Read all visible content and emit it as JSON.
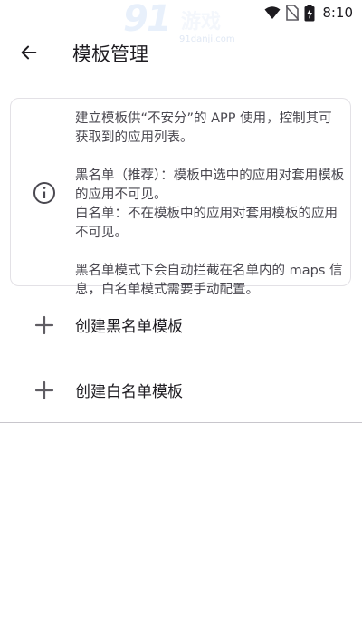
{
  "status_bar": {
    "time": "8:10",
    "icons": [
      "wifi-icon",
      "no-sim-icon",
      "battery-charging-icon"
    ]
  },
  "watermark": {
    "logo_number": "91",
    "logo_text": "游戏",
    "url": "91danji.com"
  },
  "app_bar": {
    "back_icon": "arrow-back-icon",
    "title": "模板管理"
  },
  "info_card": {
    "icon": "info-icon",
    "intro": "建立模板供“不安分”的 APP 使用，控制其可获取到的应用列表。",
    "blacklist_desc": "黑名单（推荐）：模板中选中的应用对套用模板的应用不可见。",
    "whitelist_desc": "白名单：不在模板中的应用对套用模板的应用不可见。",
    "note": "黑名单模式下会自动拦截在名单内的 maps 信息，白名单模式需要手动配置。"
  },
  "actions": [
    {
      "icon": "plus-icon",
      "label": "创建黑名单模板"
    },
    {
      "icon": "plus-icon",
      "label": "创建白名单模板"
    }
  ]
}
